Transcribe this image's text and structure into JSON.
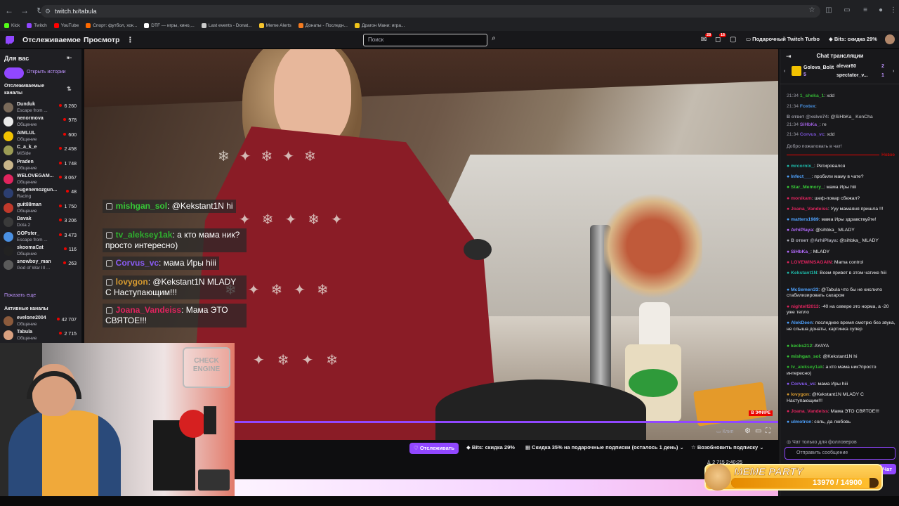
{
  "browser": {
    "url": "twitch.tv/tabula",
    "bookmarks": [
      "Kick",
      "Twitch",
      "YouTube",
      "Спорт: футбол, хок...",
      "DTF — игры, кино,...",
      "Last events - Donat...",
      "Meme Alerts",
      "Донаты - Последн...",
      "Драгон Мани: игра..."
    ],
    "bookmark_colors": [
      "#53fc18",
      "#9147ff",
      "#ff0000",
      "#ff6a00",
      "#ffffff",
      "#cccccc",
      "#f7c52d",
      "#f47b20",
      "#f0c419"
    ]
  },
  "header": {
    "following": "Отслеживаемое",
    "browse": "Просмотр",
    "more_icon": "⋮",
    "search_placeholder": "Поиск",
    "notif_badge_1": "28",
    "notif_badge_2": "16",
    "turbo": "Подарочный Twitch Turbo",
    "bits": "Bits: скидка 29%"
  },
  "sidebar": {
    "for_you": "Для вас",
    "open_stories": "Открыть истории",
    "followed_title": "Отслеживаемые каналы",
    "channels": [
      {
        "name": "Dunduk",
        "game": "Escape from ...",
        "viewers": "6 260",
        "color": "#7a6a5a"
      },
      {
        "name": "nenormova",
        "game": "Общение",
        "viewers": "978",
        "color": "#eaeaea"
      },
      {
        "name": "AIMLUL",
        "game": "Общение",
        "viewers": "600",
        "color": "#f2c200"
      },
      {
        "name": "C_a_k_e",
        "game": "MiSide",
        "viewers": "2 458",
        "color": "#9c9c55"
      },
      {
        "name": "Praden",
        "game": "Общение",
        "viewers": "1 748",
        "color": "#c9b58a"
      },
      {
        "name": "WELOVEGAM...",
        "game": "Общение",
        "viewers": "3 067",
        "color": "#e0245e"
      },
      {
        "name": "eugenemozgun...",
        "game": "Racing",
        "viewers": "48",
        "color": "#2c3e70"
      },
      {
        "name": "guit88man",
        "game": "Общение",
        "viewers": "1 750",
        "color": "#c0392b"
      },
      {
        "name": "Davak",
        "game": "Dota 2",
        "viewers": "3 206",
        "color": "#3a3a3a"
      },
      {
        "name": "GOPster_",
        "game": "Escape from ...",
        "viewers": "3 473",
        "color": "#4a90e2"
      },
      {
        "name": "skoomaCat",
        "game": "Общение",
        "viewers": "116",
        "color": "#222222"
      },
      {
        "name": "snowboy_man",
        "game": "God of War III ...",
        "viewers": "263",
        "color": "#5a5a5a"
      }
    ],
    "show_more": "Показать еще",
    "active_title": "Активные каналы",
    "active_channels": [
      {
        "name": "evelone2004",
        "game": "Общение",
        "viewers": "42 707",
        "color": "#8b5a3c"
      },
      {
        "name": "Tabula",
        "game": "Общение",
        "viewers": "2 715",
        "color": "#d9a07f"
      }
    ]
  },
  "overlay_chat": [
    {
      "user": "mishgan_sol",
      "text": "@Kekstant1N hi",
      "ucolor": "#37c837"
    },
    {
      "user": "tv_aleksey1ak",
      "text": "а кто мама ник?просто интересно)",
      "ucolor": "#2fb12f"
    },
    {
      "user": "Corvus_vc",
      "text": "мама Иры hiii",
      "ucolor": "#8a5cf6"
    },
    {
      "user": "lovygon",
      "text": "@Kekstant1N MLADY С Наступающим!!!",
      "ucolor": "#d89b2f"
    },
    {
      "user": "Joana_Vandeiss",
      "text": "Мама ЭТО СВЯТОЕ!!!",
      "ucolor": "#e0245e"
    }
  ],
  "video": {
    "live": "В ЭФИРЕ",
    "clip": "Клип",
    "progress": 1.0
  },
  "webcam": {
    "sign": "CHECK ENGINE"
  },
  "bottom": {
    "follow": "Отслеживать",
    "bits": "Bits: скидка 29%",
    "gift_subs": "Скидка 35% на подарочные подписки (осталось 1 день)",
    "renew": "Возобновить подписку",
    "viewers": "2 715",
    "uptime": "2:40:25"
  },
  "chat": {
    "title": "Chat трансляции",
    "gifter1": "Golova_Bolit",
    "gifter1_count": "5",
    "gifter2": "alevar80",
    "gifter2_count": "2",
    "gifter3": "spectator_v...",
    "gifter3_count": "1",
    "old_messages": [
      {
        "time": "21:34",
        "user": "1_sheka_1",
        "text": ": xdd",
        "ucolor": "#37c837"
      },
      {
        "time": "21:34",
        "user": "Foxtex",
        "text": ": ",
        "ucolor": "#4fa3ff"
      },
      {
        "time": "",
        "user": "В ответ @xslve74:",
        "text": " @SiHbKa_ KonCha",
        "ucolor": "#adadb8"
      },
      {
        "time": "21:34",
        "user": "SiHbKa_",
        "text": ": ге",
        "ucolor": "#b56bff"
      },
      {
        "time": "21:34",
        "user": "Corvus_vc",
        "text": ": xdd",
        "ucolor": "#8a5cf6"
      }
    ],
    "welcome": "Добро пожаловать в чат!",
    "new_label": "Новое",
    "messages": [
      {
        "user": "mrcornix_",
        "text": ": Ретировался",
        "ucolor": "#1eb8a8"
      },
      {
        "user": "Infect___",
        "text": ": пробили маму в чате?",
        "ucolor": "#4fa3ff"
      },
      {
        "user": "Star_Memory_",
        "text": ": мама Иры hiii",
        "ucolor": "#37c837"
      },
      {
        "user": "monikam",
        "text": ": шеф-повар сбежал?",
        "ucolor": "#e0245e"
      },
      {
        "user": "Joana_Vandeiss",
        "text": ": Ууу мамаяня пришла !!!",
        "ucolor": "#e0245e"
      },
      {
        "user": "matters1989",
        "text": ": мама Иры здравствуйте!",
        "ucolor": "#4fa3ff"
      },
      {
        "user": "ArhiPlaya",
        "text": ": @sihbka_ MLADY",
        "ucolor": "#b56bff"
      },
      {
        "user": "В ответ @ArhiPlaya:",
        "text": " @sihbka_ MLADY",
        "ucolor": "#adadb8"
      },
      {
        "user": "SiHbKa_",
        "text": ": MLADY",
        "ucolor": "#b56bff"
      },
      {
        "user": "LOVEWINSAGAIN",
        "text": ": Mama control",
        "ucolor": "#e0245e"
      },
      {
        "user": "Kekstant1N",
        "text": ": Всем привет в этом чатике hiii",
        "ucolor": "#1eb8a8"
      },
      {
        "user": "McSemen33",
        "text": ": @Tabula что бы не кислило стабилизировать сахаром",
        "ucolor": "#4fa3ff"
      },
      {
        "user": "nightelf2013",
        "text": ": -40 на севере это норма, а -20 уже тепло",
        "ucolor": "#e0245e"
      },
      {
        "user": "AlekDeen",
        "text": ": последнее время смотрю без звука, не слыша донаты, картинка супер",
        "ucolor": "#4fa3ff"
      },
      {
        "user": "kecks212",
        "text": ": AYAYA",
        "ucolor": "#37c837"
      },
      {
        "user": "mishgan_sol",
        "text": ": @Kekstant1N hi",
        "ucolor": "#37c837"
      },
      {
        "user": "tv_aleksey1ak",
        "text": ": а кто мама ник?просто интересно)",
        "ucolor": "#2fb12f"
      },
      {
        "user": "Corvus_vc",
        "text": ": мама Иры hiii",
        "ucolor": "#8a5cf6"
      },
      {
        "user": "lovygon",
        "text": ": @Kekstant1N MLADY С Наступающим!!!",
        "ucolor": "#d89b2f"
      },
      {
        "user": "Joana_Vandeiss",
        "text": ": Мама ЭТО СВЯТОЕ!!!",
        "ucolor": "#e0245e"
      },
      {
        "user": "ulmotron",
        "text": ": соль, да любовь",
        "ucolor": "#4fa3ff"
      }
    ],
    "followers_only": "Чат только для фолловеров",
    "input_placeholder": "Отправить сообщение",
    "chat_button": "Чат"
  },
  "meme_party": {
    "title": "MEME PARTY",
    "progress_text": "13970 / 14900",
    "progress": 0.9376
  }
}
